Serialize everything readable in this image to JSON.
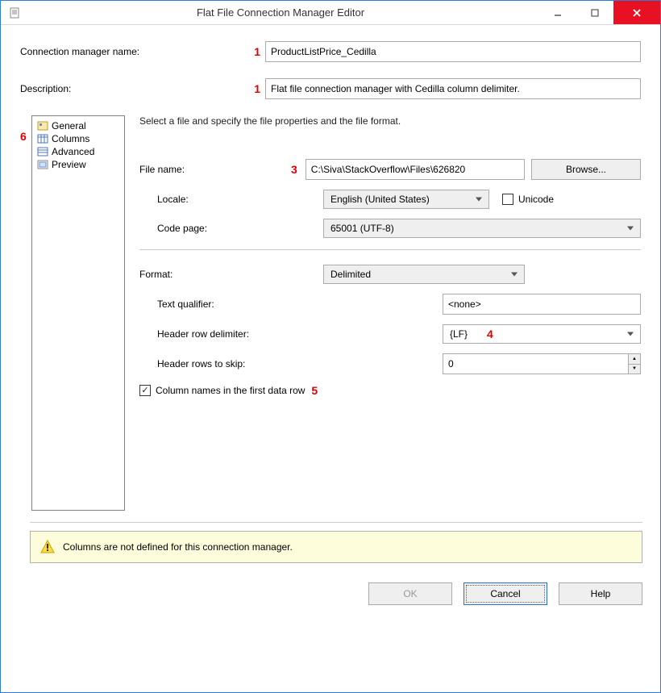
{
  "window": {
    "title": "Flat File Connection Manager Editor"
  },
  "header": {
    "conn_name_label": "Connection manager name:",
    "conn_name_value": "ProductListPrice_Cedilla",
    "description_label": "Description:",
    "description_value": "Flat file connection manager with Cedilla column delimiter."
  },
  "nav": {
    "items": [
      "General",
      "Columns",
      "Advanced",
      "Preview"
    ]
  },
  "page": {
    "instruction": "Select a file and specify the file properties and the file format.",
    "file_name_label": "File name:",
    "file_name_value": "C:\\Siva\\StackOverflow\\Files\\626820",
    "browse_label": "Browse...",
    "locale_label": "Locale:",
    "locale_value": "English (United States)",
    "unicode_label": "Unicode",
    "unicode_checked": false,
    "code_page_label": "Code page:",
    "code_page_value": "65001 (UTF-8)",
    "format_label": "Format:",
    "format_value": "Delimited",
    "text_qualifier_label": "Text qualifier:",
    "text_qualifier_value": "<none>",
    "header_delim_label": "Header row delimiter:",
    "header_delim_value": "{LF}",
    "header_skip_label": "Header rows to skip:",
    "header_skip_value": "0",
    "col_names_label": "Column names in the first data row",
    "col_names_checked": true
  },
  "warning": {
    "text": "Columns are not defined for this connection manager."
  },
  "buttons": {
    "ok": "OK",
    "cancel": "Cancel",
    "help": "Help"
  },
  "annotations": {
    "a1": "1",
    "a3": "3",
    "a4": "4",
    "a5": "5",
    "a6": "6"
  }
}
